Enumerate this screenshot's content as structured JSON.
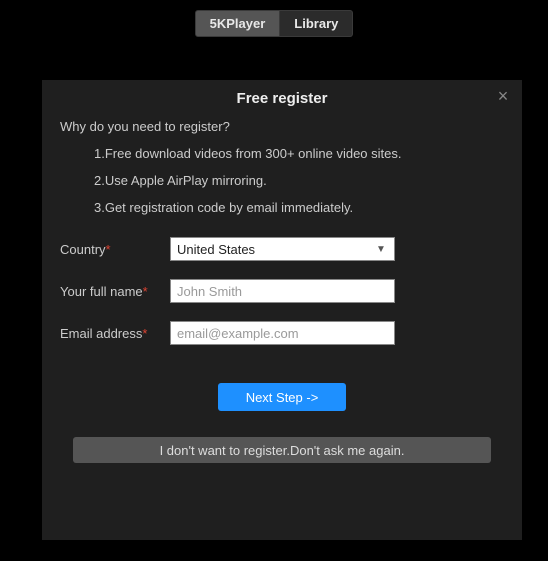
{
  "tabs": {
    "player": "5KPlayer",
    "library": "Library"
  },
  "dialog": {
    "title": "Free register",
    "why": "Why do you need to register?",
    "reasons": [
      "1.Free download videos from 300+ online video sites.",
      "2.Use Apple AirPlay mirroring.",
      "3.Get registration code by email immediately."
    ],
    "fields": {
      "country": {
        "label": "Country",
        "value": "United States"
      },
      "name": {
        "label": "Your full name",
        "placeholder": "John Smith"
      },
      "email": {
        "label": "Email address",
        "placeholder": "email@example.com"
      }
    },
    "next": "Next Step ->",
    "skip": "I don't want to register.Don't ask me again."
  }
}
